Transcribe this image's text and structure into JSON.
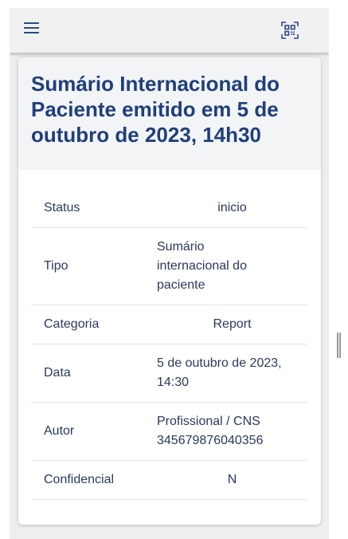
{
  "header": {
    "menu_icon": "menu-icon",
    "qr_icon": "qr-code-scan-icon"
  },
  "card": {
    "title": "Sumário Internacional do Paciente emitido em 5 de outubro de 2023, 14h30"
  },
  "details": [
    {
      "label": "Status",
      "value": "inicio"
    },
    {
      "label": "Tipo",
      "value": "Sumário internacional do paciente"
    },
    {
      "label": "Categoria",
      "value": "Report"
    },
    {
      "label": "Data",
      "value": "5 de outubro de 2023, 14:30"
    },
    {
      "label": "Autor",
      "value": "Profissional / CNS 345679876040356"
    },
    {
      "label": "Confidencial",
      "value": "N"
    }
  ],
  "colors": {
    "accent": "#1f3f7c",
    "text": "#2a3a5c",
    "appbar_bg": "#f1f1f1",
    "page_bg": "#eeeeee"
  }
}
